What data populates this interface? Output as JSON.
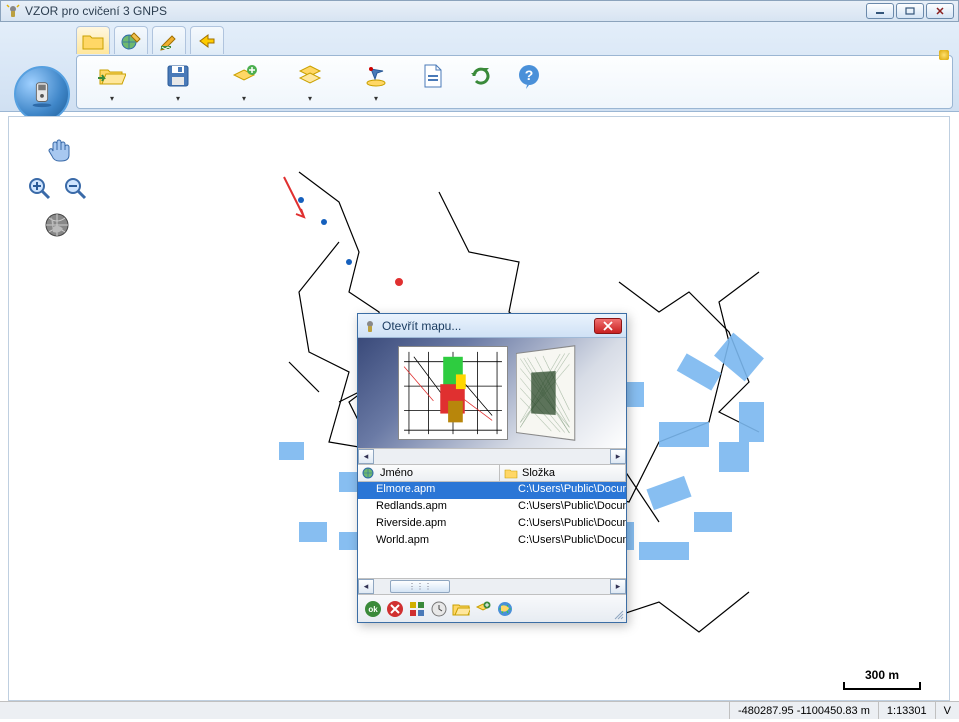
{
  "window": {
    "title": "VZOR pro cvičení 3 GNPS"
  },
  "dialog": {
    "title": "Otevřít mapu...",
    "columns": {
      "name": "Jméno",
      "folder": "Složka"
    },
    "rows": [
      {
        "name": "Elmore.apm",
        "folder": "C:\\Users\\Public\\Docum"
      },
      {
        "name": "Redlands.apm",
        "folder": "C:\\Users\\Public\\Docum"
      },
      {
        "name": "Riverside.apm",
        "folder": "C:\\Users\\Public\\Docum"
      },
      {
        "name": "World.apm",
        "folder": "C:\\Users\\Public\\Docum"
      }
    ],
    "selected_index": 0
  },
  "scale": {
    "label": "300 m"
  },
  "status": {
    "coords": "-480287.95 -1100450.83 m",
    "ratio": "1:13301",
    "mode": "V"
  }
}
